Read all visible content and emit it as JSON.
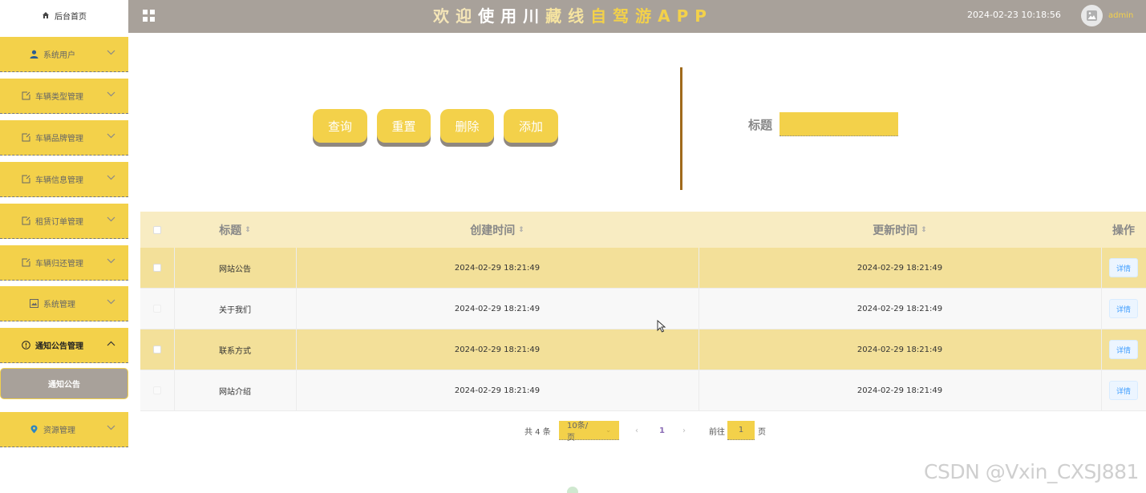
{
  "header": {
    "title_chars": [
      {
        "c": "欢",
        "color": "#f5e6b8"
      },
      {
        "c": "迎",
        "color": "#f5e6b8"
      },
      {
        "c": "使",
        "color": "#ffffff"
      },
      {
        "c": "用",
        "color": "#ffffff"
      },
      {
        "c": "川",
        "color": "#ffffff"
      },
      {
        "c": "藏",
        "color": "#f6e4a0"
      },
      {
        "c": "线",
        "color": "#f6e4a0"
      },
      {
        "c": "自",
        "color": "#f3d14a"
      },
      {
        "c": "驾",
        "color": "#f3d14a"
      },
      {
        "c": "游",
        "color": "#f3d14a"
      },
      {
        "c": "A",
        "color": "#f3d14a"
      },
      {
        "c": "P",
        "color": "#f3d14a"
      },
      {
        "c": "P",
        "color": "#f3d14a"
      }
    ],
    "datetime": "2024-02-23 10:18:56",
    "username": "admin",
    "colors": {
      "header_bg": "#a8a19a",
      "accent": "#f3d14a"
    }
  },
  "sidebar": {
    "home": "后台首页",
    "items": [
      {
        "label": "系统用户",
        "icon": "user-icon"
      },
      {
        "label": "车辆类型管理",
        "icon": "edit-doc-icon"
      },
      {
        "label": "车辆品牌管理",
        "icon": "edit-doc-icon"
      },
      {
        "label": "车辆信息管理",
        "icon": "edit-doc-icon"
      },
      {
        "label": "租赁订单管理",
        "icon": "edit-doc-icon"
      },
      {
        "label": "车辆归还管理",
        "icon": "edit-doc-icon"
      },
      {
        "label": "系统管理",
        "icon": "picture-icon"
      },
      {
        "label": "通知公告管理",
        "icon": "info-circle-icon"
      },
      {
        "label": "资源管理",
        "icon": "location-icon"
      }
    ],
    "active_sub": "通知公告"
  },
  "actions": {
    "query": "查询",
    "reset": "重置",
    "delete": "删除",
    "add": "添加"
  },
  "search": {
    "label": "标题",
    "value": ""
  },
  "table": {
    "headers": {
      "title": "标题",
      "created": "创建时间",
      "updated": "更新时间",
      "ops": "操作"
    },
    "rows": [
      {
        "title": "网站公告",
        "created": "2024-02-29 18:21:49",
        "updated": "2024-02-29 18:21:49",
        "action": "详情"
      },
      {
        "title": "关于我们",
        "created": "2024-02-29 18:21:49",
        "updated": "2024-02-29 18:21:49",
        "action": "详情"
      },
      {
        "title": "联系方式",
        "created": "2024-02-29 18:21:49",
        "updated": "2024-02-29 18:21:49",
        "action": "详情"
      },
      {
        "title": "网站介绍",
        "created": "2024-02-29 18:21:49",
        "updated": "2024-02-29 18:21:49",
        "action": "详情"
      }
    ]
  },
  "pagination": {
    "total": "共 4 条",
    "page_size": "10条/页",
    "prev": "‹",
    "current": "1",
    "next": "›",
    "goto_label": "前往",
    "goto_value": "1",
    "page_suffix": "页"
  },
  "watermark": "CSDN @Vxin_CXSJ881"
}
